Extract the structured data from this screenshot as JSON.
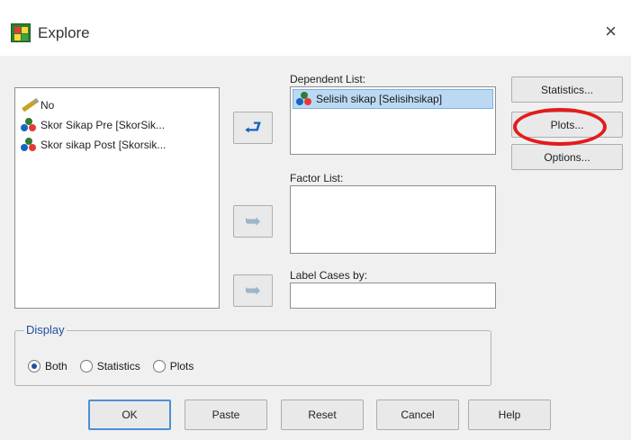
{
  "window": {
    "title": "Explore",
    "close": "×"
  },
  "variables": [
    {
      "label": "No",
      "icon": "pencil-icon"
    },
    {
      "label": "Skor Sikap Pre [SkorSik...",
      "icon": "scale-icon"
    },
    {
      "label": "Skor sikap Post [Skorsik...",
      "icon": "scale-icon"
    }
  ],
  "dependent": {
    "label": "Dependent List:",
    "items": [
      "Selisih sikap [Selisihsikap]"
    ]
  },
  "factor": {
    "label": "Factor List:"
  },
  "label_cases": {
    "label": "Label Cases by:",
    "value": ""
  },
  "arrows": {
    "move": "➥",
    "add": "➡"
  },
  "side_buttons": {
    "statistics": "Statistics...",
    "plots": "Plots...",
    "options": "Options..."
  },
  "display": {
    "title": "Display",
    "options": [
      "Both",
      "Statistics",
      "Plots"
    ],
    "selected": "Both"
  },
  "bottom_buttons": {
    "ok": "OK",
    "paste": "Paste",
    "reset": "Reset",
    "cancel": "Cancel",
    "help": "Help"
  },
  "colors": {
    "highlight": "#e31b1b",
    "selection": "#bcd9f3",
    "accent": "#1f4e9c"
  }
}
